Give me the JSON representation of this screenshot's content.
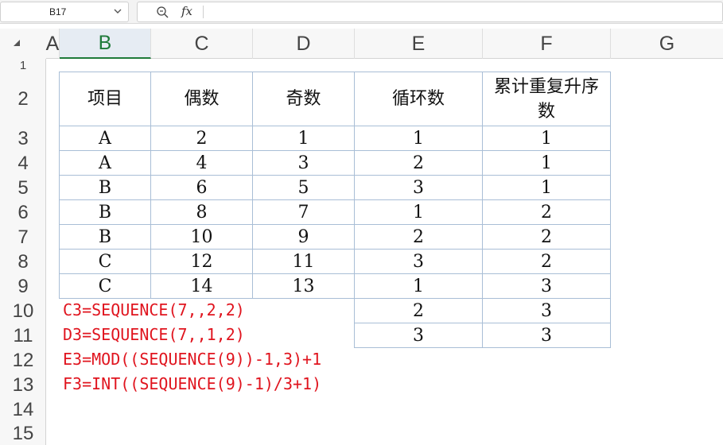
{
  "name_box": {
    "value": "B17"
  },
  "formula_bar": {
    "zoom_icon": "zoom-icon",
    "fx_label": "fx",
    "content": ""
  },
  "columns": [
    "A",
    "B",
    "C",
    "D",
    "E",
    "F",
    "G"
  ],
  "selected_column": "B",
  "rows": [
    "1",
    "2",
    "3",
    "4",
    "5",
    "6",
    "7",
    "8",
    "9",
    "10",
    "11",
    "12",
    "13",
    "14",
    "15"
  ],
  "table": {
    "headers": [
      "项目",
      "偶数",
      "奇数",
      "循环数",
      "累计重复升序数"
    ],
    "rows": [
      [
        "A",
        "2",
        "1",
        "1",
        "1"
      ],
      [
        "A",
        "4",
        "3",
        "2",
        "1"
      ],
      [
        "B",
        "6",
        "5",
        "3",
        "1"
      ],
      [
        "B",
        "8",
        "7",
        "1",
        "2"
      ],
      [
        "B",
        "10",
        "9",
        "2",
        "2"
      ],
      [
        "C",
        "12",
        "11",
        "3",
        "2"
      ],
      [
        "C",
        "14",
        "13",
        "1",
        "3"
      ]
    ],
    "extra_rows": [
      [
        "2",
        "3"
      ],
      [
        "3",
        "3"
      ]
    ]
  },
  "formulas": [
    "C3=SEQUENCE(7,,2,2)",
    "D3=SEQUENCE(7,,1,2)",
    "E3=MOD((SEQUENCE(9))-1,3)+1",
    "F3=INT((SEQUENCE(9)-1)/3+1)"
  ],
  "colors": {
    "accent": "#1f7a3a",
    "formula_text": "#e0141e",
    "grid_border": "#a9bed6"
  }
}
